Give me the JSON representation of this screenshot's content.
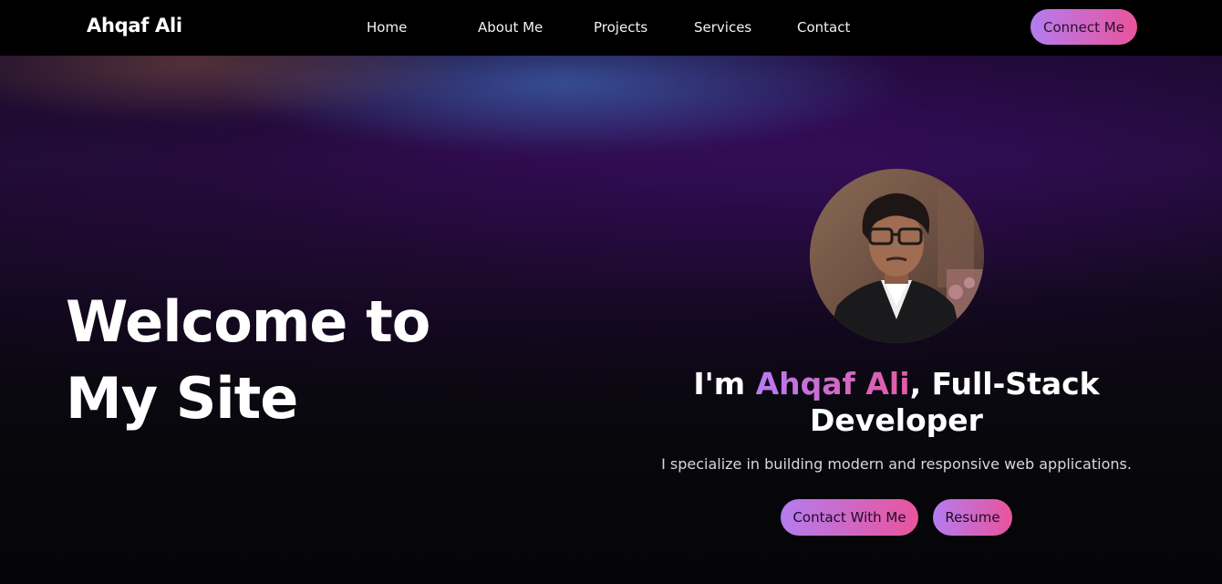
{
  "navbar": {
    "brand": "Ahqaf Ali",
    "links": [
      {
        "label": "Home"
      },
      {
        "label": "About Me"
      },
      {
        "label": "Projects"
      },
      {
        "label": "Services"
      },
      {
        "label": "Contact"
      }
    ],
    "cta_label": "Connect Me"
  },
  "hero": {
    "heading_line1": "Welcome to",
    "heading_line2": "My Site",
    "intro_prefix": "I'm ",
    "intro_name": "Ahqaf Ali",
    "intro_suffix": ", Full-Stack Developer",
    "tagline": "I specialize in building modern and responsive web applications.",
    "primary_button": "Contact With Me",
    "secondary_button": "Resume"
  },
  "colors": {
    "accent_start": "#b47cf0",
    "accent_end": "#e9549b",
    "navbar_bg": "#000000"
  }
}
